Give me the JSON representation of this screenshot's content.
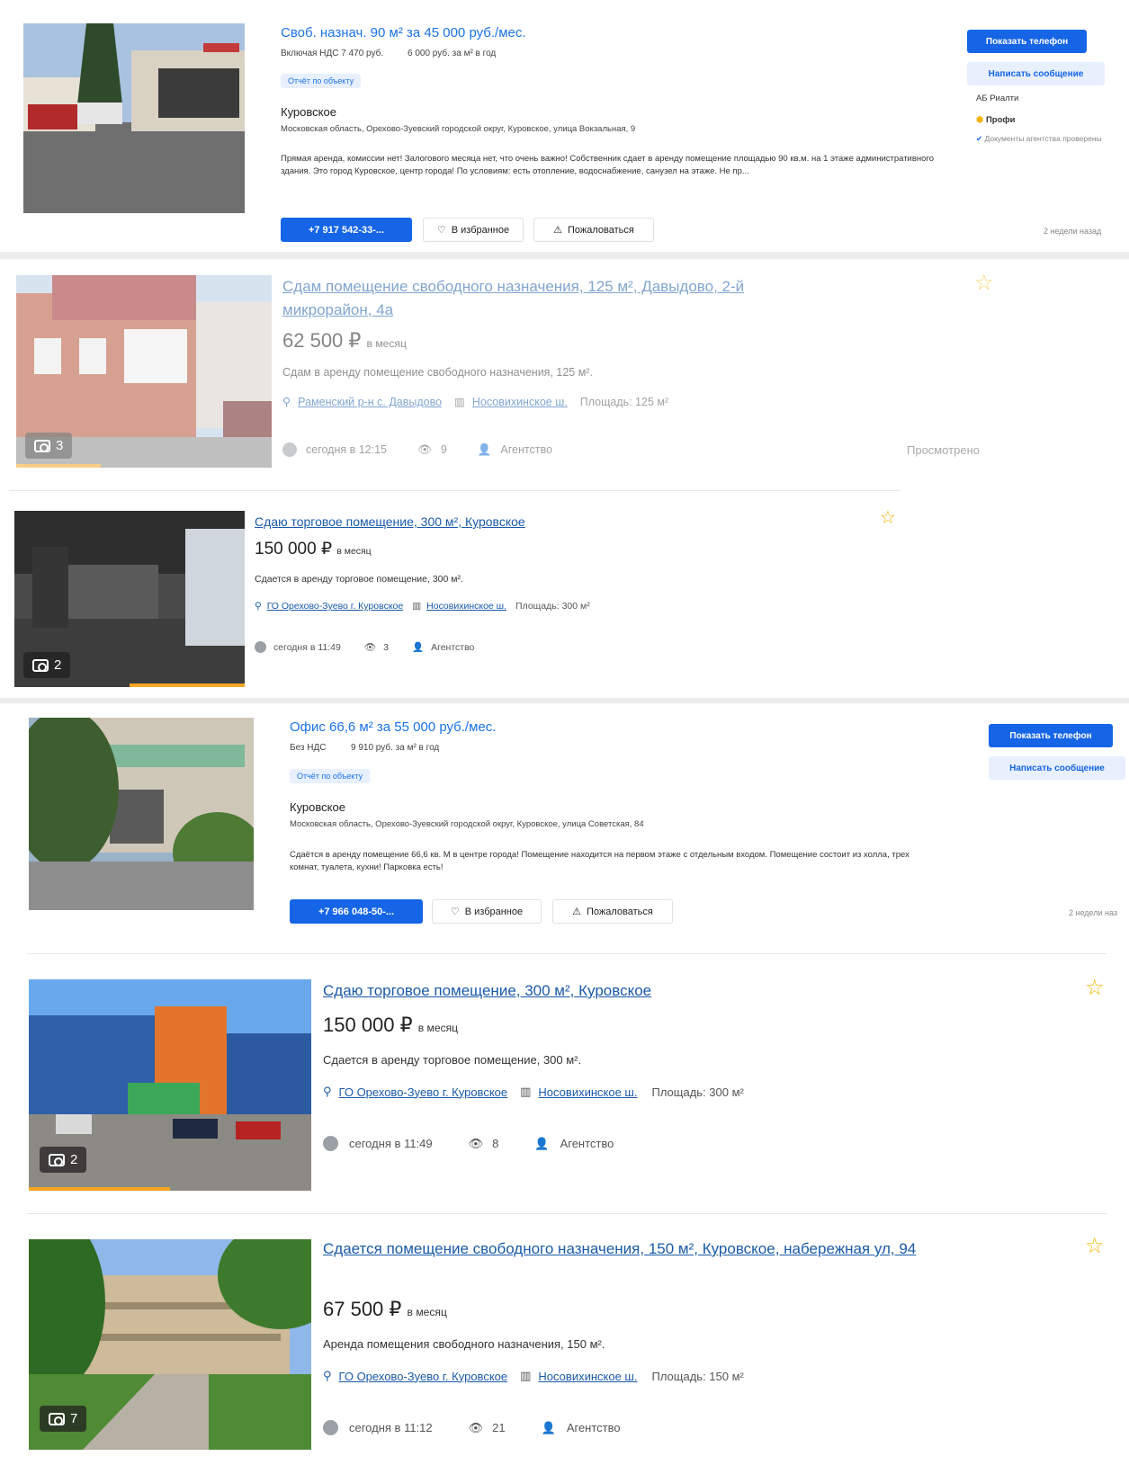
{
  "listing1": {
    "title": "Своб. назнач. 90 м² за 45 000 руб./мес.",
    "vat": "Включая НДС 7 470 руб.",
    "per_sqm": "6 000 руб. за м² в год",
    "report": "Отчёт по объекту",
    "locality": "Куровское",
    "address": "Московская область, Орехово-Зуевский городской округ, Куровское, улица Вокзальная, 9",
    "description": "Прямая аренда, комиссии нет! Залогового месяца нет, что очень важно! Собственник сдает в аренду помещение площадью 90 кв.м. на 1 этаже административного здания. Это город Куровское, центр города! По условиям: есть отопление, водоснабжение, санузел на этаже. Не пр...",
    "phone": "+7 917 542-33-...",
    "favorite": "В избранное",
    "complain": "Пожаловаться",
    "show_phone": "Показать телефон",
    "write_msg": "Написать сообщение",
    "agency": "АБ Риалти",
    "pro": "Профи",
    "docs": "Документы агентства проверены",
    "posted": "2 недели назад"
  },
  "listing2": {
    "title": "Сдам помещение свободного назначения, 125 м², Давыдово, 2-й микрорайон, 4а",
    "price": "62 500 ₽",
    "per": "в месяц",
    "description": "Сдам в аренду помещение свободного назначения, 125 м².",
    "location": "Раменский р-н с. Давыдово",
    "highway": "Носовихинское ш.",
    "area": "Площадь: 125 м²",
    "time": "сегодня в 12:15",
    "views": "9",
    "seller": "Агентство",
    "photos": "3",
    "viewed": "Просмотрено"
  },
  "listing3": {
    "title": "Сдаю торговое помещение, 300 м², Куровское",
    "price": "150 000 ₽",
    "per": "в месяц",
    "description": "Сдается в аренду торговое помещение, 300 м².",
    "location": "ГО Орехово-Зуево г. Куровское",
    "highway": "Носовихинское ш.",
    "area": "Площадь: 300 м²",
    "time": "сегодня в 11:49",
    "views": "3",
    "seller": "Агентство",
    "photos": "2"
  },
  "listing4": {
    "title": "Офис 66,6 м² за 55 000 руб./мес.",
    "vat": "Без НДС",
    "per_sqm": "9 910 руб. за м² в год",
    "report": "Отчёт по объекту",
    "locality": "Куровское",
    "address": "Московская область, Орехово-Зуевский городской округ, Куровское, улица Советская, 84",
    "description": "Сдаётся в аренду помещение 66,6 кв. М в центре города! Помещение находится на первом этаже с отдельным входом. Помещение состоит из холла, трех комнат, туалета, кухни! Парковка есть!",
    "phone": "+7 966 048-50-...",
    "favorite": "В избранное",
    "complain": "Пожаловаться",
    "show_phone": "Показать телефон",
    "write_msg": "Написать сообщение",
    "posted": "2 недели наз"
  },
  "listing5": {
    "title": "Сдаю торговое помещение, 300 м², Куровское",
    "price": "150 000 ₽",
    "per": "в месяц",
    "description": "Сдается в аренду торговое помещение, 300 м².",
    "location": "ГО Орехово-Зуево г. Куровское",
    "highway": "Носовихинское ш.",
    "area": "Площадь: 300 м²",
    "time": "сегодня в 11:49",
    "views": "8",
    "seller": "Агентство",
    "photos": "2"
  },
  "listing6": {
    "title": "Сдается помещение свободного назначения, 150 м², Куровское, набережная ул, 94",
    "price": "67 500 ₽",
    "per": "в месяц",
    "description": "Аренда помещения свободного назначения, 150 м².",
    "location": "ГО Орехово-Зуево г. Куровское",
    "highway": "Носовихинское ш.",
    "area": "Площадь: 150 м²",
    "time": "сегодня в 11:12",
    "views": "21",
    "seller": "Агентство",
    "photos": "7"
  },
  "colors": {
    "accent": "#1565e6",
    "link": "#1a5aa8",
    "star": "#f5b400",
    "photo_bar": "#f5a623"
  }
}
